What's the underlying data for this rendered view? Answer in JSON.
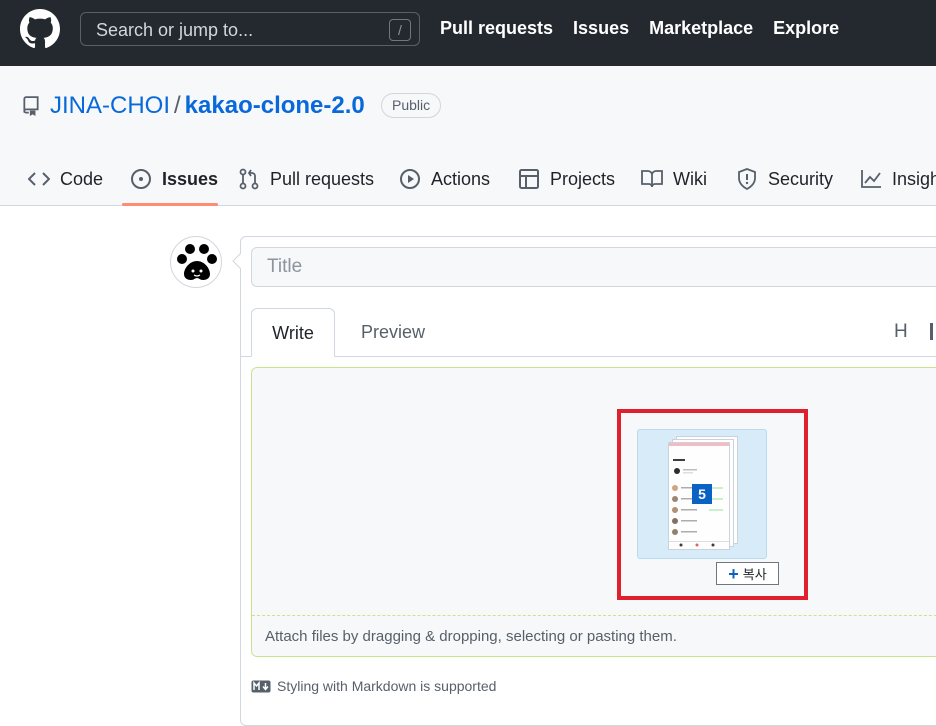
{
  "header": {
    "search_placeholder": "Search or jump to...",
    "search_shortcut": "/",
    "nav": [
      "Pull requests",
      "Issues",
      "Marketplace",
      "Explore"
    ]
  },
  "repo": {
    "owner": "JINA-CHOI",
    "separator": "/",
    "name": "kakao-clone-2.0",
    "visibility": "Public"
  },
  "tabs": {
    "code": "Code",
    "issues": "Issues",
    "pull_requests": "Pull requests",
    "actions": "Actions",
    "projects": "Projects",
    "wiki": "Wiki",
    "security": "Security",
    "insights": "Insights"
  },
  "composer": {
    "title_placeholder": "Title",
    "write_tab": "Write",
    "preview_tab": "Preview",
    "toolbar_heading": "H",
    "attach_text": "Attach files by dragging & dropping, selecting or pasting them.",
    "markdown_note": "Styling with Markdown is supported"
  },
  "drag_overlay": {
    "file_count": "5",
    "copy_label": "복사"
  },
  "colors": {
    "header_bg": "#24292f",
    "link": "#0969da",
    "active_tab_underline": "#fd8c73",
    "highlight_box": "#e0202f",
    "dropzone_border": "#c8e58d"
  }
}
